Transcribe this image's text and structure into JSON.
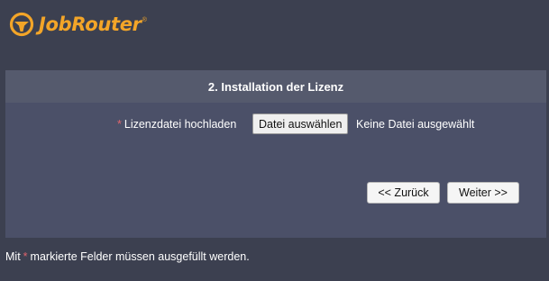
{
  "brand": {
    "name": "JobRouter",
    "registered_mark": "®",
    "accent_color": "#f3a528"
  },
  "panel": {
    "title": "2. Installation der Lizenz",
    "license_field": {
      "required_marker": "*",
      "label": "Lizenzdatei hochladen",
      "button_label": "Datei auswählen",
      "status": "Keine Datei ausgewählt"
    },
    "nav": {
      "back_label": "<< Zurück",
      "next_label": "Weiter >>"
    }
  },
  "footnote": {
    "prefix": "Mit",
    "marker": "*",
    "suffix": "markierte Felder müssen ausgefüllt werden."
  },
  "colors": {
    "background": "#3c4050",
    "panel": "#4b5068",
    "panel_header": "#555a6d",
    "required": "#e0646c"
  }
}
